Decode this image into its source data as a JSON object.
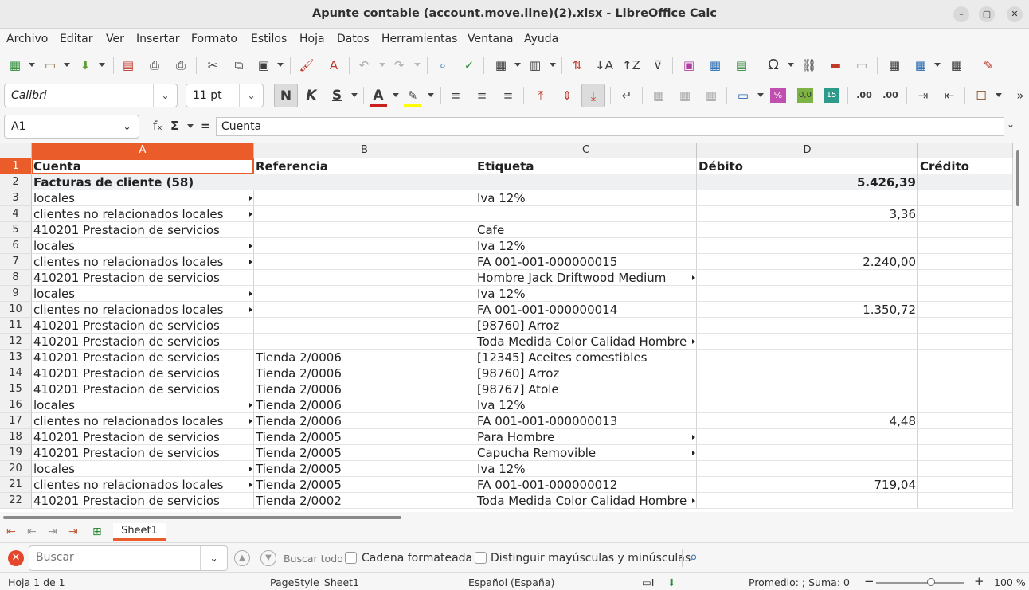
{
  "window": {
    "title": "Apunte contable (account.move.line)(2).xlsx - LibreOffice Calc",
    "minimize_glyph": "–",
    "maximize_glyph": "▢",
    "close_glyph": "✕"
  },
  "menu": [
    "Archivo",
    "Editar",
    "Ver",
    "Insertar",
    "Formato",
    "Estilos",
    "Hoja",
    "Datos",
    "Herramientas",
    "Ventana",
    "Ayuda"
  ],
  "toolbar2": {
    "font_name": "Calibri",
    "font_size": "11 pt",
    "bold": "N",
    "italic": "K",
    "underline": "S",
    "font_color_letter": "A",
    "font_color": "#c9211e",
    "highlight_color": "#ffff00"
  },
  "formula": {
    "cell_ref": "A1",
    "fx": "fₓ",
    "sigma": "Σ",
    "equals": "=",
    "content": "Cuenta"
  },
  "sheet": {
    "columns": [
      "A",
      "B",
      "C",
      "D",
      ""
    ],
    "selected_column": "A",
    "header_row": [
      "Cuenta",
      "Referencia",
      "Etiqueta",
      "Débito",
      "Crédito"
    ],
    "group_row": {
      "label": "Facturas de cliente (58)",
      "debit": "5.426,39"
    },
    "rows": [
      {
        "n": "3",
        "a": "locales",
        "b": "",
        "c": "Iva 12%",
        "d": ""
      },
      {
        "n": "4",
        "a": "clientes no relacionados locales",
        "b": "",
        "c": "",
        "d": "3,36"
      },
      {
        "n": "5",
        "a": "410201 Prestacion de servicios",
        "b": "",
        "c": "Cafe",
        "d": ""
      },
      {
        "n": "6",
        "a": "locales",
        "b": "",
        "c": "Iva 12%",
        "d": ""
      },
      {
        "n": "7",
        "a": "clientes no relacionados locales",
        "b": "",
        "c": "FA 001-001-000000015",
        "d": "2.240,00"
      },
      {
        "n": "8",
        "a": "410201 Prestacion de servicios",
        "b": "",
        "c": "Hombre Jack Driftwood Medium",
        "d": ""
      },
      {
        "n": "9",
        "a": "locales",
        "b": "",
        "c": "Iva 12%",
        "d": ""
      },
      {
        "n": "10",
        "a": "clientes no relacionados locales",
        "b": "",
        "c": "FA 001-001-000000014",
        "d": "1.350,72"
      },
      {
        "n": "11",
        "a": "410201 Prestacion de servicios",
        "b": "",
        "c": "[98760] Arroz",
        "d": ""
      },
      {
        "n": "12",
        "a": "410201 Prestacion de servicios",
        "b": "",
        "c": "Toda Medida Color Calidad Hombre",
        "d": ""
      },
      {
        "n": "13",
        "a": "410201 Prestacion de servicios",
        "b": "Tienda 2/0006",
        "c": "[12345] Aceites comestibles",
        "d": ""
      },
      {
        "n": "14",
        "a": "410201 Prestacion de servicios",
        "b": "Tienda 2/0006",
        "c": "[98760] Arroz",
        "d": ""
      },
      {
        "n": "15",
        "a": "410201 Prestacion de servicios",
        "b": "Tienda 2/0006",
        "c": "[98767] Atole",
        "d": ""
      },
      {
        "n": "16",
        "a": "locales",
        "b": "Tienda 2/0006",
        "c": "Iva 12%",
        "d": ""
      },
      {
        "n": "17",
        "a": "clientes no relacionados locales",
        "b": "Tienda 2/0006",
        "c": "FA 001-001-000000013",
        "d": "4,48"
      },
      {
        "n": "18",
        "a": "410201 Prestacion de servicios",
        "b": "Tienda 2/0005",
        "c": "Para Hombre",
        "d": ""
      },
      {
        "n": "19",
        "a": "410201 Prestacion de servicios",
        "b": "Tienda 2/0005",
        "c": "Capucha Removible",
        "d": ""
      },
      {
        "n": "20",
        "a": "locales",
        "b": "Tienda 2/0005",
        "c": "Iva 12%",
        "d": ""
      },
      {
        "n": "21",
        "a": "clientes no relacionados locales",
        "b": "Tienda 2/0005",
        "c": "FA 001-001-000000012",
        "d": "719,04"
      },
      {
        "n": "22",
        "a": "410201 Prestacion de servicios",
        "b": "Tienda 2/0002",
        "c": "Toda Medida Color Calidad Hombre",
        "d": ""
      }
    ],
    "overflow_a_rows": [
      "3",
      "4",
      "6",
      "7",
      "9",
      "10",
      "16",
      "17",
      "20",
      "21"
    ],
    "overflow_c_rows": [
      "8",
      "12",
      "18",
      "19",
      "22"
    ]
  },
  "tabs": {
    "sheet_name": "Sheet1"
  },
  "find": {
    "placeholder": "Buscar",
    "find_all": "Buscar todo",
    "formatted": "Cadena formateada",
    "match_case": "Distinguir mayúsculas y minúsculas"
  },
  "status": {
    "sheet": "Hoja 1 de 1",
    "page_style": "PageStyle_Sheet1",
    "language": "Español (España)",
    "sum": "Promedio: ; Suma: 0",
    "zoom_minus": "−",
    "zoom_plus": "+",
    "zoom": "100 %"
  }
}
